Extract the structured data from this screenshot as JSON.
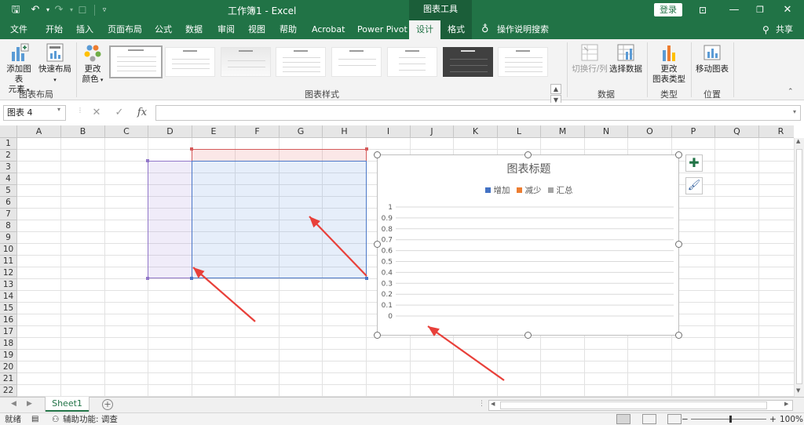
{
  "titlebar": {
    "doc_title": "工作簿1  -  Excel",
    "contextual_group": "图表工具",
    "login": "登录",
    "qa_save_icon": "save-icon",
    "qa_undo_icon": "undo-icon",
    "qa_redo_icon": "redo-icon",
    "qa_touch_icon": "touch-mode-icon",
    "qa_customize_icon": "customize-qat-icon"
  },
  "tabs": [
    {
      "label": "文件"
    },
    {
      "label": "开始"
    },
    {
      "label": "插入"
    },
    {
      "label": "页面布局"
    },
    {
      "label": "公式"
    },
    {
      "label": "数据"
    },
    {
      "label": "审阅"
    },
    {
      "label": "视图"
    },
    {
      "label": "帮助"
    },
    {
      "label": "Acrobat"
    },
    {
      "label": "Power Pivot"
    },
    {
      "label": "设计"
    },
    {
      "label": "格式"
    }
  ],
  "tell_me": "操作说明搜索",
  "share": "共享",
  "ribbon": {
    "add_element_1": "添加图表",
    "add_element_2": "元素",
    "quick_layout": "快速布局",
    "change_colors_1": "更改",
    "change_colors_2": "颜色",
    "group_chart_layout": "图表布局",
    "group_chart_styles": "图表样式",
    "switch_row_col": "切换行/列",
    "select_data": "选择数据",
    "group_data": "数据",
    "change_type_1": "更改",
    "change_type_2": "图表类型",
    "group_type": "类型",
    "move_chart": "移动图表",
    "group_location": "位置"
  },
  "formula_bar": {
    "name_box": "图表 4",
    "cancel_icon": "✕",
    "enter_icon": "✓",
    "fx_icon": "fx",
    "formula": ""
  },
  "columns": [
    "A",
    "B",
    "C",
    "D",
    "E",
    "F",
    "G",
    "H",
    "I",
    "J",
    "K",
    "L",
    "M",
    "N",
    "O",
    "P",
    "Q",
    "R"
  ],
  "rows": [
    "1",
    "2",
    "3",
    "4",
    "5",
    "6",
    "7",
    "8",
    "9",
    "10",
    "11",
    "12",
    "13",
    "14",
    "15",
    "16",
    "17",
    "18",
    "19",
    "20",
    "21",
    "22"
  ],
  "chart_data": {
    "type": "bar",
    "title": "图表标题",
    "categories": [],
    "series": [
      {
        "name": "增加",
        "color": "#4472c4",
        "values": []
      },
      {
        "name": "减少",
        "color": "#ed7d31",
        "values": []
      },
      {
        "name": "汇总",
        "color": "#a5a5a5",
        "values": []
      }
    ],
    "ylim": [
      0,
      1
    ],
    "yticks": [
      "0",
      "0.1",
      "0.2",
      "0.3",
      "0.4",
      "0.5",
      "0.6",
      "0.7",
      "0.8",
      "0.9",
      "1"
    ],
    "grid": true,
    "legend_position": "top"
  },
  "arrow_color": "#e8403a",
  "sheets": {
    "active": "Sheet1"
  },
  "status": {
    "ready": "就绪",
    "accessibility": "辅助功能: 调查",
    "zoom": "100%"
  }
}
